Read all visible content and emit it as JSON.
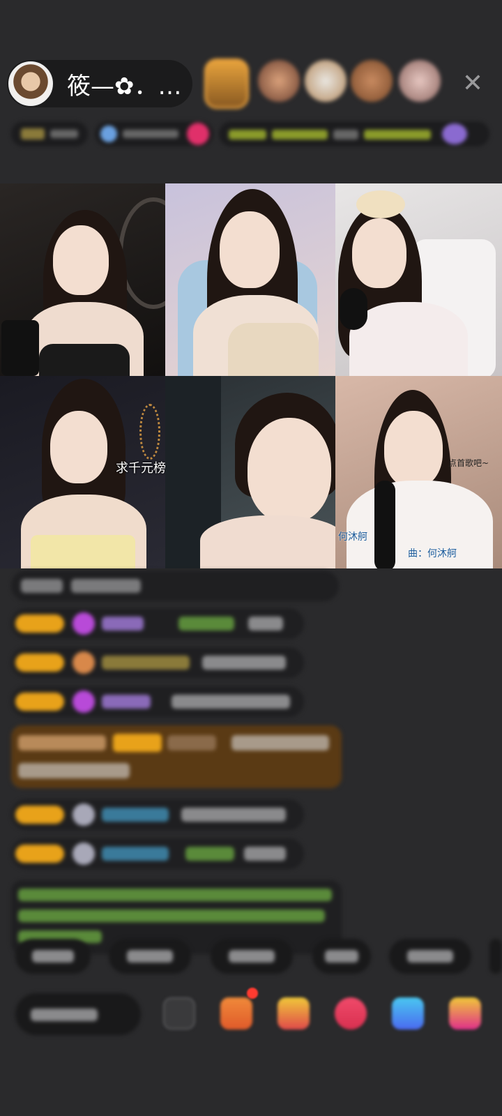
{
  "host": {
    "name": "筱—✿．…",
    "avatar_icon": "host-avatar"
  },
  "viewers": [
    "viewer-avatar",
    "viewer-avatar",
    "viewer-avatar",
    "viewer-avatar",
    "viewer-avatar"
  ],
  "close_icon": "close-icon",
  "close_glyph": "✕",
  "video_grid": {
    "cells": [
      {
        "position": "top-left"
      },
      {
        "position": "top-middle"
      },
      {
        "position": "top-right"
      },
      {
        "position": "bottom-left",
        "overlay_text": "求千元榜"
      },
      {
        "position": "bottom-middle"
      },
      {
        "position": "bottom-right",
        "overlay_text_left": "何沐舸",
        "overlay_text_right": "曲：何沐舸",
        "overlay_text_top": "点首歌吧~"
      }
    ]
  },
  "colors": {
    "background": "#2a2a2c",
    "badge_orange": "#e8a21a",
    "highlight_brown": "#5a3a14",
    "green_text": "#7fb84a",
    "red_dot": "#ff3b30"
  },
  "bottom_icons": [
    "keyboard-icon",
    "gift-box-icon",
    "gift-icon",
    "heart-icon",
    "game-icon",
    "more-icon"
  ]
}
